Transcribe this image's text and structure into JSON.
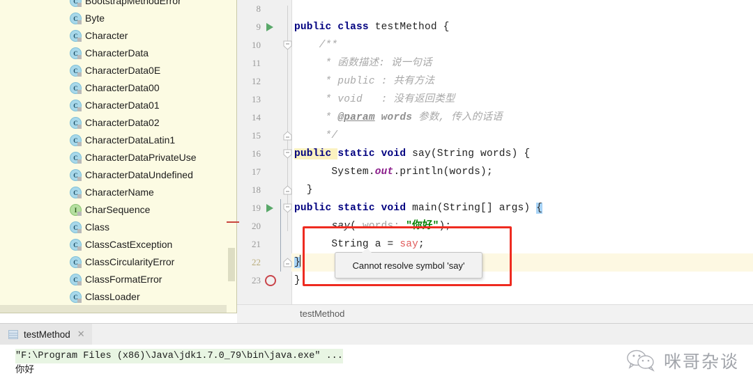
{
  "editor": {
    "first_visible_line": 8,
    "lines": [
      {
        "num": "8",
        "marker": "none",
        "fold": "none",
        "segments": []
      },
      {
        "num": "9",
        "marker": "run",
        "fold": "none",
        "segments": [
          {
            "t": "public ",
            "c": "kw"
          },
          {
            "t": "class ",
            "c": "kw"
          },
          {
            "t": "testMethod {",
            "c": "plain"
          }
        ]
      },
      {
        "num": "10",
        "marker": "none",
        "fold": "open",
        "segments": [
          {
            "t": "    /**",
            "c": "cmt"
          }
        ]
      },
      {
        "num": "11",
        "marker": "none",
        "fold": "none",
        "segments": [
          {
            "t": "     * 函数描述: 说一句话",
            "c": "cmt"
          }
        ]
      },
      {
        "num": "12",
        "marker": "none",
        "fold": "none",
        "segments": [
          {
            "t": "     * public : 共有方法",
            "c": "cmt"
          }
        ]
      },
      {
        "num": "13",
        "marker": "none",
        "fold": "none",
        "segments": [
          {
            "t": "     * void   : 没有返回类型",
            "c": "cmt"
          }
        ]
      },
      {
        "num": "14",
        "marker": "none",
        "fold": "none",
        "segments": [
          {
            "t": "     * ",
            "c": "cmt"
          },
          {
            "t": "@param",
            "c": "cmt-tag"
          },
          {
            "t": " words",
            "c": "cmt-b"
          },
          {
            "t": " 参数, 传入的话语",
            "c": "cmt"
          }
        ]
      },
      {
        "num": "15",
        "marker": "none",
        "fold": "close",
        "segments": [
          {
            "t": "     */",
            "c": "cmt"
          }
        ]
      },
      {
        "num": "16",
        "marker": "none",
        "fold": "open",
        "segments": [
          {
            "t": "public ",
            "c": "kw-hl"
          },
          {
            "t": "static ",
            "c": "kw"
          },
          {
            "t": "void ",
            "c": "kw"
          },
          {
            "t": "say(String words) {",
            "c": "plain"
          }
        ]
      },
      {
        "num": "17",
        "marker": "none",
        "fold": "none",
        "segments": [
          {
            "t": "      System.",
            "c": "plain"
          },
          {
            "t": "out",
            "c": "field"
          },
          {
            "t": ".println(words);",
            "c": "plain"
          }
        ]
      },
      {
        "num": "18",
        "marker": "none",
        "fold": "close",
        "segments": [
          {
            "t": "  }",
            "c": "plain"
          }
        ]
      },
      {
        "num": "19",
        "marker": "run",
        "fold": "open",
        "segments": [
          {
            "t": "public ",
            "c": "kw"
          },
          {
            "t": "static ",
            "c": "kw"
          },
          {
            "t": "void ",
            "c": "kw"
          },
          {
            "t": "main(String[] args) ",
            "c": "plain"
          },
          {
            "t": "{",
            "c": "brace-hl"
          }
        ]
      },
      {
        "num": "20",
        "marker": "none",
        "fold": "none",
        "segments": [
          {
            "t": "      say",
            "c": "mcall"
          },
          {
            "t": "( ",
            "c": "plain"
          },
          {
            "t": "words:",
            "c": "hint"
          },
          {
            "t": " ",
            "c": "plain"
          },
          {
            "t": "\"你好\"",
            "c": "str"
          },
          {
            "t": ");",
            "c": "plain"
          }
        ]
      },
      {
        "num": "21",
        "marker": "none",
        "fold": "none",
        "segments": [
          {
            "t": "      String a = ",
            "c": "plain"
          },
          {
            "t": "say",
            "c": "err"
          },
          {
            "t": ";",
            "c": "plain"
          }
        ]
      },
      {
        "num": "22",
        "marker": "none",
        "fold": "close",
        "current": true,
        "segments": [
          {
            "t": "}",
            "c": "brace-hl"
          },
          {
            "t": "",
            "c": "caret"
          }
        ]
      },
      {
        "num": "23",
        "marker": "error",
        "fold": "none",
        "segments": [
          {
            "t": "}",
            "c": "plain"
          }
        ]
      }
    ]
  },
  "completion_popup": {
    "items": [
      {
        "label": "BootstrapMethodError",
        "kind": "class"
      },
      {
        "label": "Byte",
        "kind": "class"
      },
      {
        "label": "Character",
        "kind": "class"
      },
      {
        "label": "CharacterData",
        "kind": "class"
      },
      {
        "label": "CharacterData0E",
        "kind": "class"
      },
      {
        "label": "CharacterData00",
        "kind": "class"
      },
      {
        "label": "CharacterData01",
        "kind": "class"
      },
      {
        "label": "CharacterData02",
        "kind": "class"
      },
      {
        "label": "CharacterDataLatin1",
        "kind": "class"
      },
      {
        "label": "CharacterDataPrivateUse",
        "kind": "class"
      },
      {
        "label": "CharacterDataUndefined",
        "kind": "class"
      },
      {
        "label": "CharacterName",
        "kind": "class"
      },
      {
        "label": "CharSequence",
        "kind": "interface"
      },
      {
        "label": "Class",
        "kind": "class"
      },
      {
        "label": "ClassCastException",
        "kind": "class"
      },
      {
        "label": "ClassCircularityError",
        "kind": "class"
      },
      {
        "label": "ClassFormatError",
        "kind": "class"
      },
      {
        "label": "ClassLoader",
        "kind": "class"
      }
    ],
    "icon_class_letter": "C",
    "icon_interface_letter": "I"
  },
  "error_tooltip": {
    "message": "Cannot resolve symbol 'say'"
  },
  "breadcrumb": {
    "text": "testMethod"
  },
  "run_panel": {
    "tab_label": "testMethod",
    "tab_close": "✕",
    "console_lines": [
      {
        "text": "\"F:\\Program Files (x86)\\Java\\jdk1.7.0_79\\bin\\java.exe\" ...",
        "kind": "cmd"
      },
      {
        "text": "你好",
        "kind": "out"
      }
    ]
  },
  "watermark": {
    "text": "咪哥杂谈"
  },
  "colors": {
    "popup_bg": "#fcfbe3",
    "keyword": "#000080",
    "string": "#008000",
    "error_red": "#e05a5a",
    "highlight_box": "#ee2b20",
    "current_line": "#fdf8e2",
    "console_cmd_bg": "#e8f5e3",
    "run_arrow_green": "#59a869"
  }
}
